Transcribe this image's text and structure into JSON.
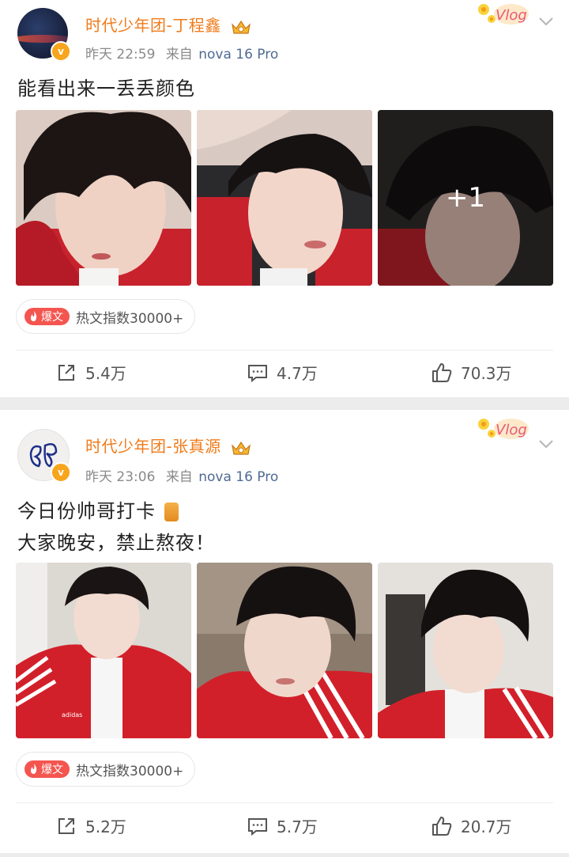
{
  "posts": [
    {
      "username": "时代少年团-丁程鑫",
      "time": "昨天 22:59",
      "source_prefix": "来自",
      "device": "nova 16 Pro",
      "text_lines": [
        "能看出来一丢丢颜色"
      ],
      "image_overlay": "+1",
      "hot_tag": "爆文",
      "hot_text": "热文指数30000+",
      "reposts": "5.4万",
      "comments": "4.7万",
      "likes": "70.3万",
      "vlog_badge": "Vlog"
    },
    {
      "username": "时代少年团-张真源",
      "time": "昨天 23:06",
      "source_prefix": "来自",
      "device": "nova 16 Pro",
      "text_lines": [
        "今日份帅哥打卡",
        "大家晚安，禁止熬夜！"
      ],
      "hot_tag": "爆文",
      "hot_text": "热文指数30000+",
      "reposts": "5.2万",
      "comments": "5.7万",
      "likes": "20.7万",
      "vlog_badge": "Vlog"
    }
  ],
  "colors": {
    "username": "#f07b1a",
    "device": "#4f6a94",
    "hot_tag": "#f4554f",
    "verified": "#f7a51d"
  },
  "icons": [
    "verified-icon",
    "crown-icon",
    "vlog-badge-icon",
    "chevron-down-icon",
    "flame-icon",
    "repost-icon",
    "comment-icon",
    "like-icon"
  ]
}
